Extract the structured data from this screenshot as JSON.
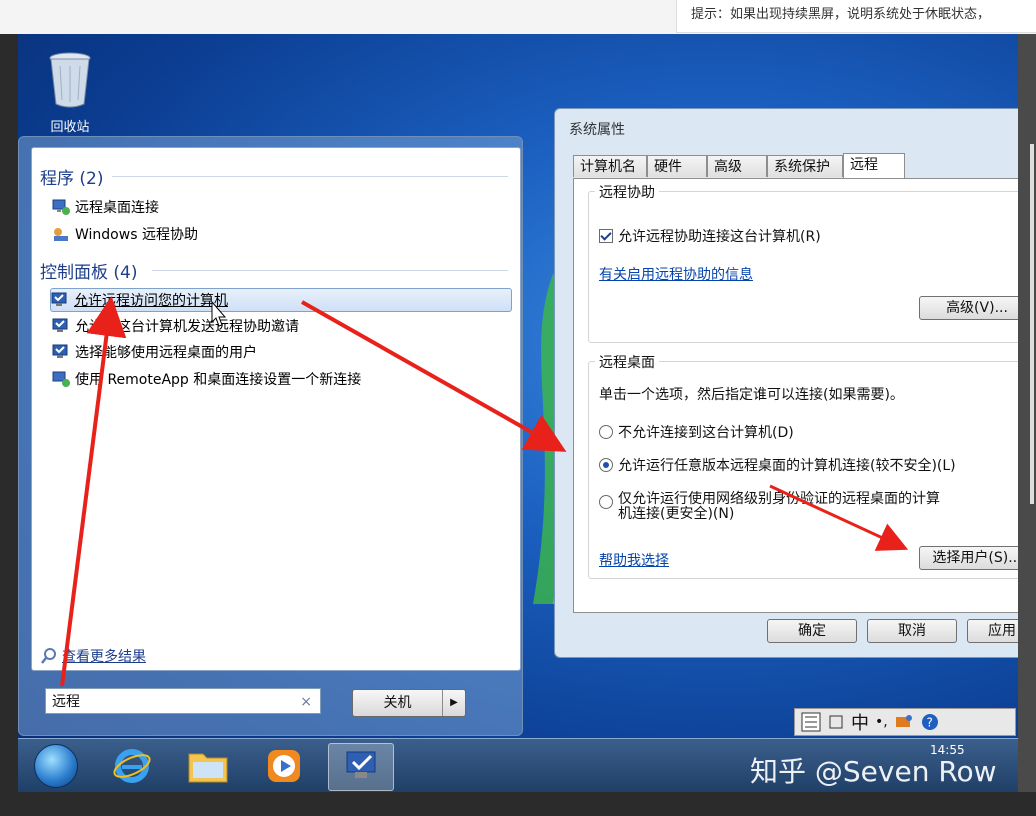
{
  "hint": "提示：如果出现持续黑屏，说明系统处于休眠状态，",
  "desktop": {
    "recycle_label": "回收站"
  },
  "start_menu": {
    "section_programs": "程序 (2)",
    "programs": [
      "远程桌面连接",
      "Windows 远程协助"
    ],
    "section_control": "控制面板 (4)",
    "control_items": [
      "允许远程访问您的计算机",
      "允许从这台计算机发送远程协助邀请",
      "选择能够使用远程桌面的用户",
      "使用 RemoteApp 和桌面连接设置一个新连接"
    ],
    "more_results": "查看更多结果",
    "search_value": "远程",
    "clear": "×",
    "shutdown": "关机",
    "shutdown_arrow": "▶"
  },
  "dialog": {
    "title": "系统属性",
    "tabs": [
      "计算机名",
      "硬件",
      "高级",
      "系统保护",
      "远程"
    ],
    "assist_title": "远程协助",
    "assist_checkbox": "允许远程协助连接这台计算机(R)",
    "assist_link": "有关启用远程协助的信息",
    "advanced_btn": "高级(V)...",
    "rd_title": "远程桌面",
    "rd_instruction": "单击一个选项，然后指定谁可以连接(如果需要)。",
    "rd_option1": "不允许连接到这台计算机(D)",
    "rd_option2": "允许运行任意版本远程桌面的计算机连接(较不安全)(L)",
    "rd_option3_line1": "仅允许运行使用网络级别身份验证的远程桌面的计算",
    "rd_option3_line2": "机连接(更安全)(N)",
    "help_link": "帮助我选择",
    "select_users_btn": "选择用户(S)...",
    "ok": "确定",
    "cancel": "取消",
    "apply": "应用"
  },
  "language_bar": {
    "ime": "中"
  },
  "taskbar": {
    "time": "14:55"
  },
  "watermark": "知乎 @Seven Row",
  "colors": {
    "arrow": "#e8221b",
    "link": "#0645ad",
    "heading": "#1e3e8c"
  }
}
